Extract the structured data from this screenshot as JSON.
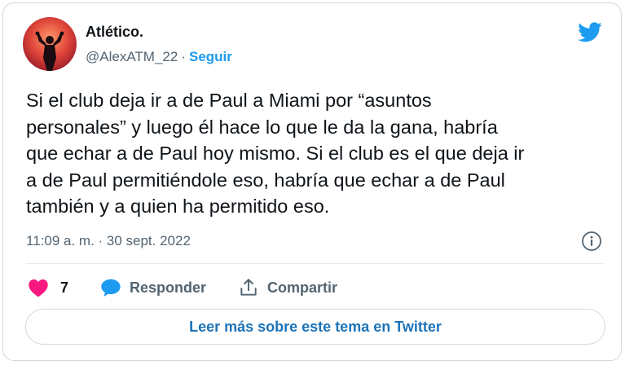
{
  "tweet": {
    "author": {
      "name": "Atlético.",
      "handle": "@AlexATM_22",
      "separator": "·",
      "follow_label": "Seguir",
      "avatar_icon": "avatar-silhouette-icon"
    },
    "text_lines": [
      "Si el club deja ir a de Paul a Miami por “asuntos",
      "personales” y luego él hace lo que le da la gana, habría",
      "que echar a de Paul hoy mismo. Si el club es el que deja ir",
      "a de Paul permitiéndole eso, habría que echar a de Paul",
      "también y a quien ha permitido eso."
    ],
    "timestamp": "11:09 a. m. · 30 sept. 2022",
    "actions": {
      "like_count": "7",
      "reply_label": "Responder",
      "share_label": "Compartir"
    },
    "read_more_label": "Leer más sobre este tema en Twitter"
  },
  "icons": {
    "brand": "twitter-bird-icon",
    "info": "info-icon",
    "like": "heart-icon",
    "reply": "speech-bubble-icon",
    "share": "share-icon"
  },
  "colors": {
    "accent": "#1d9bf0",
    "like": "#f91880",
    "link": "#1d73b8",
    "muted": "#536471",
    "text": "#0f1419",
    "border": "#cfd9de"
  }
}
